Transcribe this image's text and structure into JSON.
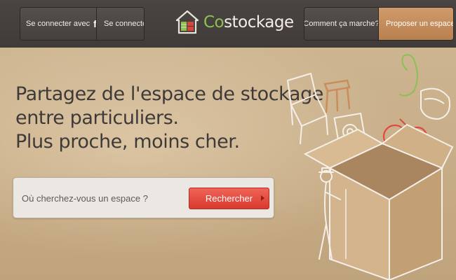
{
  "header": {
    "login_facebook_label": "Se connecter avec",
    "facebook_glyph": "f",
    "login_label": "Se connecter",
    "logo": {
      "prefix": "Co",
      "suffix": "stockage"
    },
    "how_it_works_label": "Comment ça marche?",
    "propose_space_label": "Proposer un espace"
  },
  "hero": {
    "tagline": [
      "Partagez de l'espace de stockage",
      "entre particuliers.",
      "Plus proche, moins cher."
    ]
  },
  "search": {
    "placeholder": "Où cherchez-vous un espace ?",
    "button_label": "Rechercher"
  },
  "colors": {
    "header_bg": "#45403d",
    "accent_orange": "#c98d5c",
    "search_red": "#e04a3f",
    "logo_green": "#8cc152",
    "logo_red": "#d8453b"
  }
}
